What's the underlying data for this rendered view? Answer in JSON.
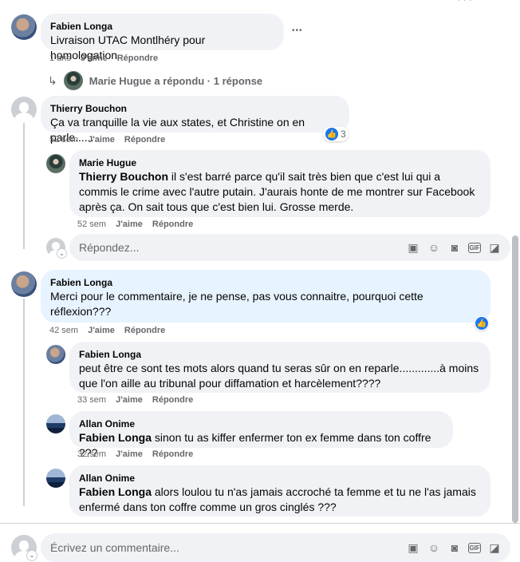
{
  "top_clip": "· · ·",
  "c1": {
    "name": "Fabien Longa",
    "text": "Livraison UTAC Montlhéry pour homologation",
    "time": "1 ans",
    "like": "J'aime",
    "reply": "Répondre",
    "more": "•••"
  },
  "replies_link": {
    "text": "Marie Hugue a répondu · 1 réponse"
  },
  "c2": {
    "name": "Thierry Bouchon",
    "text": "Ça va tranquille la vie aux states, et Christine on en parle......",
    "time": "52 sem",
    "like": "J'aime",
    "reply": "Répondre",
    "reactions": "3"
  },
  "r1": {
    "name": "Marie Hugue",
    "mention": "Thierry Bouchon",
    "text": " il s'est barré parce qu'il sait très bien que c'est lui qui a commis le crime avec l'autre putain. J'aurais honte de me montrer sur Facebook après ça. On sait tous que c'est bien lui. Grosse merde.",
    "time": "52 sem",
    "like": "J'aime",
    "reply": "Répondre"
  },
  "reply_box": {
    "placeholder": "Répondez..."
  },
  "c3": {
    "name": "Fabien Longa",
    "text": "Merci pour le commentaire, je ne pense, pas vous connaitre, pourquoi cette réflexion???",
    "time": "42 sem",
    "like": "J'aime",
    "reply": "Répondre"
  },
  "r2": {
    "name": "Fabien Longa",
    "text": "peut être ce sont tes mots alors quand tu seras sûr on en reparle.............à moins que l'on aille au tribunal pour diffamation et harcèlement????",
    "time": "33 sem",
    "like": "J'aime",
    "reply": "Répondre"
  },
  "r3": {
    "name": "Allan Onime",
    "mention": "Fabien Longa",
    "text": " sinon tu as kiffer enfermer ton ex femme dans ton coffre ???",
    "time": "32 sem",
    "like": "J'aime",
    "reply": "Répondre"
  },
  "r4": {
    "name": "Allan Onime",
    "mention": "Fabien Longa",
    "text": " alors loulou tu n'as jamais accroché ta femme et tu ne l'as jamais enfermé dans ton coffre comme un gros cinglés ???"
  },
  "comment_box": {
    "placeholder": "Écrivez un commentaire..."
  },
  "icons": [
    "sticker-icon",
    "emoji-icon",
    "camera-icon",
    "gif-icon",
    "avatar-sticker-icon"
  ],
  "accent": "#1877f2"
}
